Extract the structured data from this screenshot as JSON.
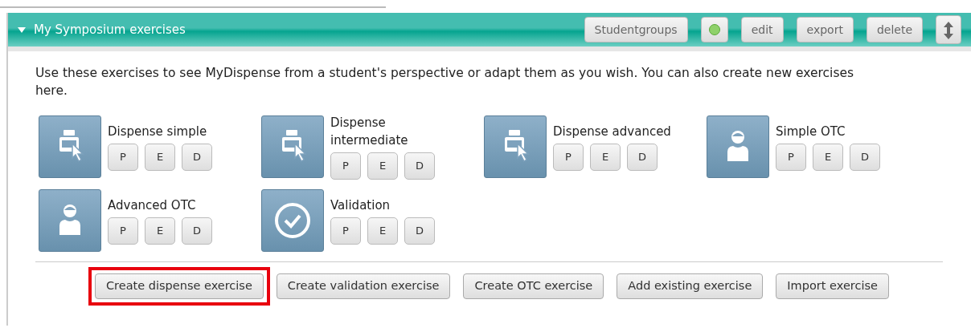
{
  "panel": {
    "title": "My Symposium exercises",
    "expanded": true,
    "status_on": true,
    "header_buttons": [
      {
        "label": "Studentgroups",
        "kind": "text"
      },
      {
        "kind": "status"
      },
      {
        "label": "edit",
        "kind": "text"
      },
      {
        "label": "export",
        "kind": "text"
      },
      {
        "label": "delete",
        "kind": "text"
      },
      {
        "kind": "move"
      }
    ],
    "description": "Use these exercises to see MyDispense from a student's perspective or adapt them as you wish. You can also create new exercises here.",
    "exercises": [
      {
        "name": "Dispense simple",
        "kind": "dispense",
        "actions": [
          "P",
          "E",
          "D"
        ]
      },
      {
        "name": "Dispense intermediate",
        "kind": "dispense",
        "actions": [
          "P",
          "E",
          "D"
        ]
      },
      {
        "name": "Dispense advanced",
        "kind": "dispense",
        "actions": [
          "P",
          "E",
          "D"
        ]
      },
      {
        "name": "Simple OTC",
        "kind": "otc",
        "actions": [
          "P",
          "E",
          "D"
        ]
      },
      {
        "name": "Advanced OTC",
        "kind": "otc",
        "actions": [
          "P",
          "E",
          "D"
        ]
      },
      {
        "name": "Validation",
        "kind": "validation",
        "actions": [
          "P",
          "E",
          "D"
        ]
      }
    ],
    "footer_buttons": [
      {
        "label": "Create dispense exercise",
        "highlighted": true
      },
      {
        "label": "Create validation exercise",
        "highlighted": false
      },
      {
        "label": "Create OTC exercise",
        "highlighted": false
      },
      {
        "label": "Add existing exercise",
        "highlighted": false
      },
      {
        "label": "Import exercise",
        "highlighted": false
      }
    ]
  }
}
